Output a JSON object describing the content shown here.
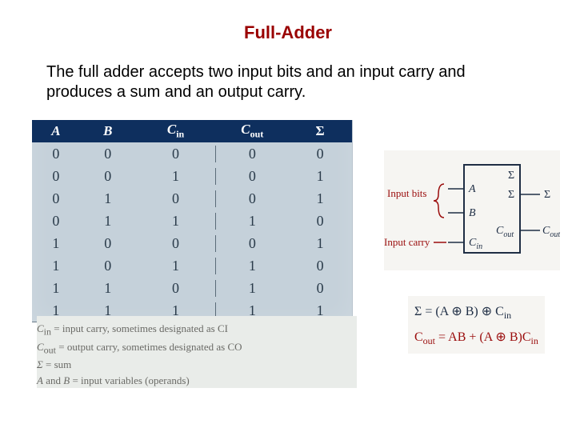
{
  "title": "Full-Adder",
  "description": "The full adder accepts two input bits and an input carry and produces a sum and an output carry.",
  "truth_table": {
    "headers": {
      "a": "A",
      "b": "B",
      "cin": "C",
      "cin_sub": "in",
      "cout": "C",
      "cout_sub": "out",
      "sum": "Σ"
    },
    "rows": [
      {
        "a": "0",
        "b": "0",
        "cin": "0",
        "cout": "0",
        "sum": "0"
      },
      {
        "a": "0",
        "b": "0",
        "cin": "1",
        "cout": "0",
        "sum": "1"
      },
      {
        "a": "0",
        "b": "1",
        "cin": "0",
        "cout": "0",
        "sum": "1"
      },
      {
        "a": "0",
        "b": "1",
        "cin": "1",
        "cout": "1",
        "sum": "0"
      },
      {
        "a": "1",
        "b": "0",
        "cin": "0",
        "cout": "0",
        "sum": "1"
      },
      {
        "a": "1",
        "b": "0",
        "cin": "1",
        "cout": "1",
        "sum": "0"
      },
      {
        "a": "1",
        "b": "1",
        "cin": "0",
        "cout": "1",
        "sum": "0"
      },
      {
        "a": "1",
        "b": "1",
        "cin": "1",
        "cout": "1",
        "sum": "1"
      }
    ]
  },
  "legend": {
    "l1a": "C",
    "l1sub": "in",
    "l1b": " = input carry, sometimes designated as CI",
    "l2a": "C",
    "l2sub": "out",
    "l2b": " = output carry, sometimes designated as CO",
    "l3a": "Σ",
    "l3b": " = sum",
    "l4a": "A",
    "l4mid": " and ",
    "l4b": "B",
    "l4c": " = input variables (operands)"
  },
  "diagram": {
    "input_bits_label": "Input bits",
    "input_carry_label": "Input carry",
    "sigma_top": "Σ",
    "pin_a": "A",
    "pin_b": "B",
    "pin_cin": "C",
    "pin_cin_sub": "in",
    "pin_sum": "Σ",
    "pin_cout": "C",
    "pin_cout_sub": "out"
  },
  "equations": {
    "eq1": "Σ = (A ⊕ B) ⊕ C",
    "eq1_sub": "in",
    "eq2": "C",
    "eq2_sub": "out",
    "eq2_rest": " = AB + (A ⊕ B)C",
    "eq2_sub2": "in"
  }
}
